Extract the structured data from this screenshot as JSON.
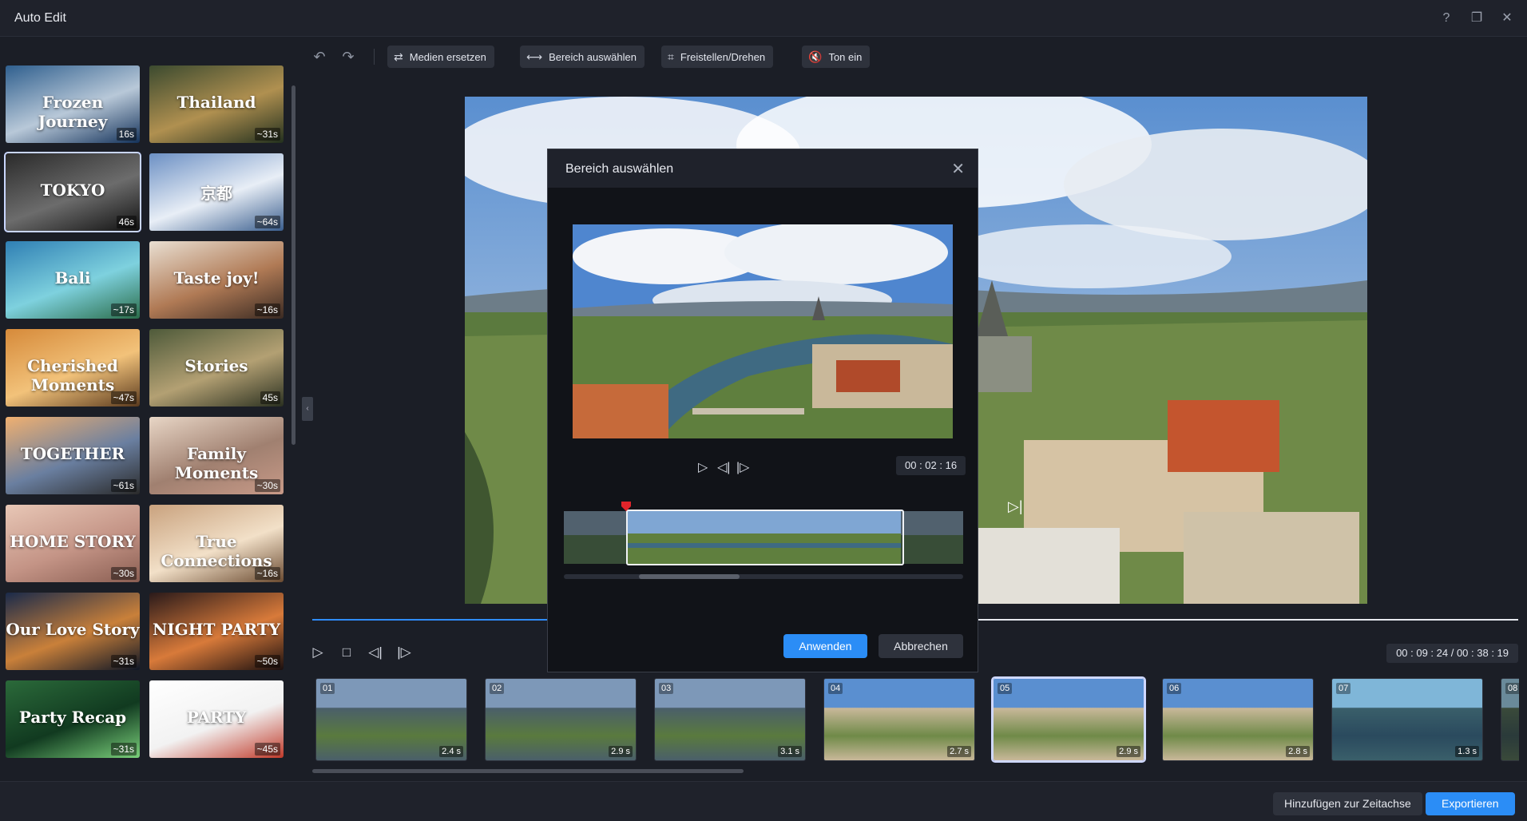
{
  "window": {
    "title": "Auto Edit"
  },
  "templates": [
    {
      "label": "Frozen Journey",
      "duration": "16s",
      "colors": [
        "#2f5f8e",
        "#b8c8d8",
        "#14325a"
      ]
    },
    {
      "label": "Thailand",
      "duration": "~31s",
      "colors": [
        "#3b4a2f",
        "#b09050",
        "#22301e"
      ]
    },
    {
      "label": "TOKYO",
      "duration": "46s",
      "colors": [
        "#2a2a2a",
        "#6c6c6c",
        "#111111"
      ],
      "selected": true
    },
    {
      "label": "京都",
      "duration": "~64s",
      "colors": [
        "#6c90c4",
        "#e8eef6",
        "#3a5e8e"
      ]
    },
    {
      "label": "Bali",
      "duration": "~17s",
      "colors": [
        "#2f7fb4",
        "#7ed1de",
        "#2b6d4a"
      ]
    },
    {
      "label": "Taste joy!",
      "duration": "~16s",
      "colors": [
        "#e9dfd2",
        "#b07a55",
        "#3a2a22"
      ]
    },
    {
      "label": "Cherished Moments",
      "duration": "~47s",
      "colors": [
        "#d68a3a",
        "#f2c27a",
        "#5a3a1e"
      ]
    },
    {
      "label": "Stories",
      "duration": "45s",
      "colors": [
        "#4e5a3a",
        "#b3a073",
        "#2a3020"
      ]
    },
    {
      "label": "TOGETHER",
      "duration": "~61s",
      "colors": [
        "#f0b070",
        "#6a7fa0",
        "#2a2a2a"
      ]
    },
    {
      "label": "Family Moments",
      "duration": "~30s",
      "colors": [
        "#e8d6c6",
        "#a08070",
        "#c89a88"
      ]
    },
    {
      "label": "HOME STORY",
      "duration": "~30s",
      "colors": [
        "#e8c7b6",
        "#c49486",
        "#8a5e52"
      ]
    },
    {
      "label": "True Connections",
      "duration": "~16s",
      "colors": [
        "#c9a27e",
        "#f2e0c8",
        "#6a4a30"
      ]
    },
    {
      "label": "Our Love Story",
      "duration": "~31s",
      "colors": [
        "#1a2a4a",
        "#c9803a",
        "#0e1626"
      ]
    },
    {
      "label": "NIGHT PARTY",
      "duration": "~50s",
      "colors": [
        "#2a1a1a",
        "#d87a3a",
        "#1a0f0f"
      ]
    },
    {
      "label": "Party Recap",
      "duration": "~31s",
      "colors": [
        "#2b6a3a",
        "#113a20",
        "#7ad07a"
      ]
    },
    {
      "label": "PARTY",
      "duration": "~45s",
      "colors": [
        "#ffffff",
        "#f2f2f2",
        "#c03a2a"
      ]
    }
  ],
  "toolbar": {
    "undo": "undo-icon",
    "redo": "redo-icon",
    "replace_media": "Medien ersetzen",
    "select_range": "Bereich auswählen",
    "crop_rotate": "Freistellen/Drehen",
    "sound_on": "Ton ein"
  },
  "playback": {
    "timecode": "00 : 09 : 24 / 00 : 38 : 19"
  },
  "clips": [
    {
      "num": "01",
      "duration": "2.4 s"
    },
    {
      "num": "02",
      "duration": "2.9 s"
    },
    {
      "num": "03",
      "duration": "3.1 s"
    },
    {
      "num": "04",
      "duration": "2.7 s"
    },
    {
      "num": "05",
      "duration": "2.9 s",
      "selected": true
    },
    {
      "num": "06",
      "duration": "2.8 s"
    },
    {
      "num": "07",
      "duration": "1.3 s"
    },
    {
      "num": "08",
      "duration": ""
    }
  ],
  "footer": {
    "add_to_timeline": "Hinzufügen zur Zeitachse",
    "export": "Exportieren"
  },
  "modal": {
    "title": "Bereich auswählen",
    "time": "00 : 02 : 16",
    "apply": "Anwenden",
    "cancel": "Abbrechen"
  },
  "colors": {
    "accent": "#2b8df6",
    "background": "#1b1e26"
  }
}
